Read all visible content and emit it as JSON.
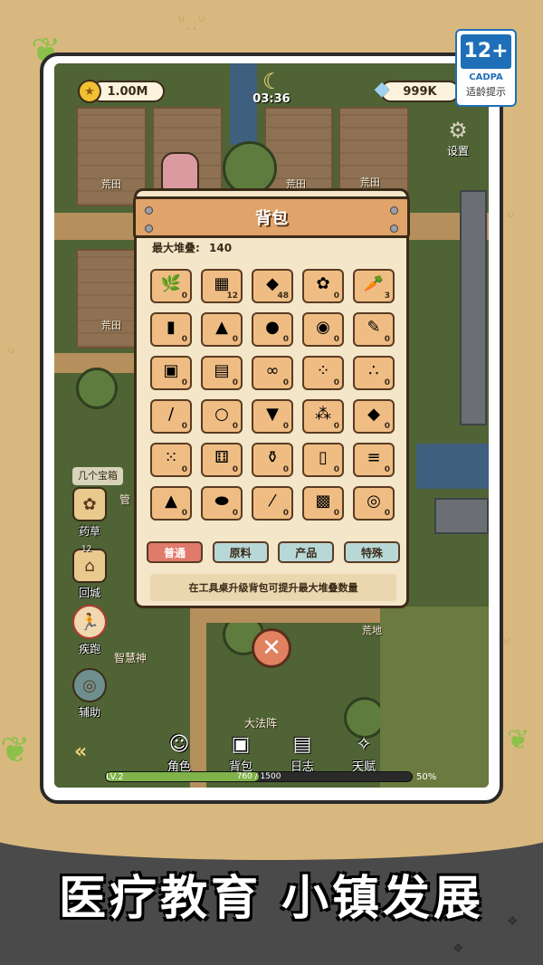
{
  "rating": {
    "age": "12+",
    "org": "CADPA",
    "tip": "适龄提示"
  },
  "hud": {
    "coins": "1.00M",
    "gems": "999K",
    "timer": "03:36",
    "settings_label": "设置"
  },
  "map_labels": {
    "wasteland_1": "荒田",
    "wasteland_2": "荒田",
    "wasteland_3": "荒田",
    "wasteland_4": "荒田",
    "wasteland_5": "荒地",
    "wisdom_god": "智慧神",
    "great_array": "大法阵",
    "chest_tip": "几个宝箱",
    "manage": "管"
  },
  "side_menu": [
    {
      "label": "药草",
      "icon": "herb-icon",
      "count": ""
    },
    {
      "label": "回城",
      "icon": "return-icon",
      "count": "12"
    },
    {
      "label": "疾跑",
      "icon": "sprint-icon",
      "count": ""
    },
    {
      "label": "辅助",
      "icon": "assist-icon",
      "count": ""
    }
  ],
  "backpack": {
    "title": "背包",
    "max_stack_label": "最大堆叠:",
    "max_stack_value": "140",
    "items": [
      {
        "icon": "🌿",
        "qty": "0",
        "name": "seaweed-icon"
      },
      {
        "icon": "▦",
        "qty": "12",
        "name": "metal-icon"
      },
      {
        "icon": "◆",
        "qty": "48",
        "name": "crystal-icon"
      },
      {
        "icon": "✿",
        "qty": "0",
        "name": "flower-icon"
      },
      {
        "icon": "🥕",
        "qty": "3",
        "name": "carrot-icon"
      },
      {
        "icon": "▮",
        "qty": "0",
        "name": "bottle-icon"
      },
      {
        "icon": "▲",
        "qty": "0",
        "name": "sand-pile-icon"
      },
      {
        "icon": "●",
        "qty": "0",
        "name": "potion-icon"
      },
      {
        "icon": "◉",
        "qty": "0",
        "name": "gear-part-icon"
      },
      {
        "icon": "✎",
        "qty": "0",
        "name": "tool-icon"
      },
      {
        "icon": "▣",
        "qty": "0",
        "name": "stone-block-icon"
      },
      {
        "icon": "▤",
        "qty": "0",
        "name": "paper-icon"
      },
      {
        "icon": "∞",
        "qty": "0",
        "name": "rope-icon"
      },
      {
        "icon": "⁘",
        "qty": "0",
        "name": "seeds-icon"
      },
      {
        "icon": "∴",
        "qty": "0",
        "name": "ore-icon"
      },
      {
        "icon": "/",
        "qty": "0",
        "name": "stick-icon"
      },
      {
        "icon": "○",
        "qty": "0",
        "name": "orb-icon"
      },
      {
        "icon": "▼",
        "qty": "0",
        "name": "ink-icon"
      },
      {
        "icon": "⁂",
        "qty": "0",
        "name": "coal-icon"
      },
      {
        "icon": "◆",
        "qty": "0",
        "name": "ruby-icon"
      },
      {
        "icon": "⁙",
        "qty": "0",
        "name": "pebbles-icon"
      },
      {
        "icon": "⚅",
        "qty": "0",
        "name": "dice-icon"
      },
      {
        "icon": "⚱",
        "qty": "0",
        "name": "jar-icon"
      },
      {
        "icon": "▯",
        "qty": "0",
        "name": "cylinder-icon"
      },
      {
        "icon": "≡",
        "qty": "0",
        "name": "planks-icon"
      },
      {
        "icon": "▲",
        "qty": "0",
        "name": "dirt-icon"
      },
      {
        "icon": "⬬",
        "qty": "0",
        "name": "bread-icon"
      },
      {
        "icon": "⁄",
        "qty": "0",
        "name": "sticks-icon"
      },
      {
        "icon": "▩",
        "qty": "0",
        "name": "chip-icon"
      },
      {
        "icon": "◎",
        "qty": "0",
        "name": "coil-icon"
      }
    ],
    "tabs": [
      "普通",
      "原料",
      "产品",
      "特殊"
    ],
    "active_tab": 0,
    "hint": "在工具桌升级背包可提升最大堆叠数量"
  },
  "bottom_nav": [
    {
      "label": "角色",
      "icon": "character-icon"
    },
    {
      "label": "背包",
      "icon": "backpack-icon"
    },
    {
      "label": "日志",
      "icon": "log-icon"
    },
    {
      "label": "天赋",
      "icon": "talent-icon"
    }
  ],
  "level": {
    "lv": "LV.2",
    "xp": "760 / 1500",
    "percent": "50%",
    "progress": 0.5
  },
  "headline": "医疗教育  小镇发展",
  "colors": {
    "accent": "#e0a36a",
    "active_tab": "#e07a6a",
    "inactive_tab": "#b8d8d8",
    "xp": "#7fb34a"
  }
}
